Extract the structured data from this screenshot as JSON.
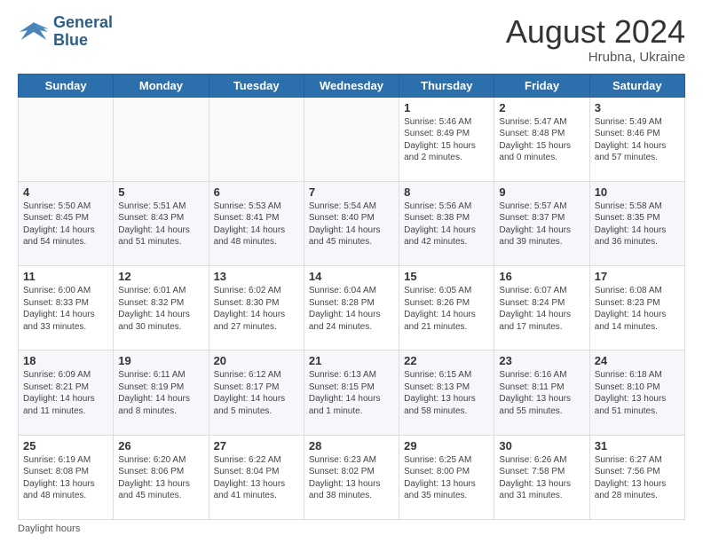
{
  "header": {
    "logo_line1": "General",
    "logo_line2": "Blue",
    "month_year": "August 2024",
    "location": "Hrubna, Ukraine"
  },
  "days_of_week": [
    "Sunday",
    "Monday",
    "Tuesday",
    "Wednesday",
    "Thursday",
    "Friday",
    "Saturday"
  ],
  "footer": {
    "daylight_label": "Daylight hours"
  },
  "weeks": [
    [
      {
        "day": "",
        "info": ""
      },
      {
        "day": "",
        "info": ""
      },
      {
        "day": "",
        "info": ""
      },
      {
        "day": "",
        "info": ""
      },
      {
        "day": "1",
        "info": "Sunrise: 5:46 AM\nSunset: 8:49 PM\nDaylight: 15 hours\nand 2 minutes."
      },
      {
        "day": "2",
        "info": "Sunrise: 5:47 AM\nSunset: 8:48 PM\nDaylight: 15 hours\nand 0 minutes."
      },
      {
        "day": "3",
        "info": "Sunrise: 5:49 AM\nSunset: 8:46 PM\nDaylight: 14 hours\nand 57 minutes."
      }
    ],
    [
      {
        "day": "4",
        "info": "Sunrise: 5:50 AM\nSunset: 8:45 PM\nDaylight: 14 hours\nand 54 minutes."
      },
      {
        "day": "5",
        "info": "Sunrise: 5:51 AM\nSunset: 8:43 PM\nDaylight: 14 hours\nand 51 minutes."
      },
      {
        "day": "6",
        "info": "Sunrise: 5:53 AM\nSunset: 8:41 PM\nDaylight: 14 hours\nand 48 minutes."
      },
      {
        "day": "7",
        "info": "Sunrise: 5:54 AM\nSunset: 8:40 PM\nDaylight: 14 hours\nand 45 minutes."
      },
      {
        "day": "8",
        "info": "Sunrise: 5:56 AM\nSunset: 8:38 PM\nDaylight: 14 hours\nand 42 minutes."
      },
      {
        "day": "9",
        "info": "Sunrise: 5:57 AM\nSunset: 8:37 PM\nDaylight: 14 hours\nand 39 minutes."
      },
      {
        "day": "10",
        "info": "Sunrise: 5:58 AM\nSunset: 8:35 PM\nDaylight: 14 hours\nand 36 minutes."
      }
    ],
    [
      {
        "day": "11",
        "info": "Sunrise: 6:00 AM\nSunset: 8:33 PM\nDaylight: 14 hours\nand 33 minutes."
      },
      {
        "day": "12",
        "info": "Sunrise: 6:01 AM\nSunset: 8:32 PM\nDaylight: 14 hours\nand 30 minutes."
      },
      {
        "day": "13",
        "info": "Sunrise: 6:02 AM\nSunset: 8:30 PM\nDaylight: 14 hours\nand 27 minutes."
      },
      {
        "day": "14",
        "info": "Sunrise: 6:04 AM\nSunset: 8:28 PM\nDaylight: 14 hours\nand 24 minutes."
      },
      {
        "day": "15",
        "info": "Sunrise: 6:05 AM\nSunset: 8:26 PM\nDaylight: 14 hours\nand 21 minutes."
      },
      {
        "day": "16",
        "info": "Sunrise: 6:07 AM\nSunset: 8:24 PM\nDaylight: 14 hours\nand 17 minutes."
      },
      {
        "day": "17",
        "info": "Sunrise: 6:08 AM\nSunset: 8:23 PM\nDaylight: 14 hours\nand 14 minutes."
      }
    ],
    [
      {
        "day": "18",
        "info": "Sunrise: 6:09 AM\nSunset: 8:21 PM\nDaylight: 14 hours\nand 11 minutes."
      },
      {
        "day": "19",
        "info": "Sunrise: 6:11 AM\nSunset: 8:19 PM\nDaylight: 14 hours\nand 8 minutes."
      },
      {
        "day": "20",
        "info": "Sunrise: 6:12 AM\nSunset: 8:17 PM\nDaylight: 14 hours\nand 5 minutes."
      },
      {
        "day": "21",
        "info": "Sunrise: 6:13 AM\nSunset: 8:15 PM\nDaylight: 14 hours\nand 1 minute."
      },
      {
        "day": "22",
        "info": "Sunrise: 6:15 AM\nSunset: 8:13 PM\nDaylight: 13 hours\nand 58 minutes."
      },
      {
        "day": "23",
        "info": "Sunrise: 6:16 AM\nSunset: 8:11 PM\nDaylight: 13 hours\nand 55 minutes."
      },
      {
        "day": "24",
        "info": "Sunrise: 6:18 AM\nSunset: 8:10 PM\nDaylight: 13 hours\nand 51 minutes."
      }
    ],
    [
      {
        "day": "25",
        "info": "Sunrise: 6:19 AM\nSunset: 8:08 PM\nDaylight: 13 hours\nand 48 minutes."
      },
      {
        "day": "26",
        "info": "Sunrise: 6:20 AM\nSunset: 8:06 PM\nDaylight: 13 hours\nand 45 minutes."
      },
      {
        "day": "27",
        "info": "Sunrise: 6:22 AM\nSunset: 8:04 PM\nDaylight: 13 hours\nand 41 minutes."
      },
      {
        "day": "28",
        "info": "Sunrise: 6:23 AM\nSunset: 8:02 PM\nDaylight: 13 hours\nand 38 minutes."
      },
      {
        "day": "29",
        "info": "Sunrise: 6:25 AM\nSunset: 8:00 PM\nDaylight: 13 hours\nand 35 minutes."
      },
      {
        "day": "30",
        "info": "Sunrise: 6:26 AM\nSunset: 7:58 PM\nDaylight: 13 hours\nand 31 minutes."
      },
      {
        "day": "31",
        "info": "Sunrise: 6:27 AM\nSunset: 7:56 PM\nDaylight: 13 hours\nand 28 minutes."
      }
    ]
  ]
}
